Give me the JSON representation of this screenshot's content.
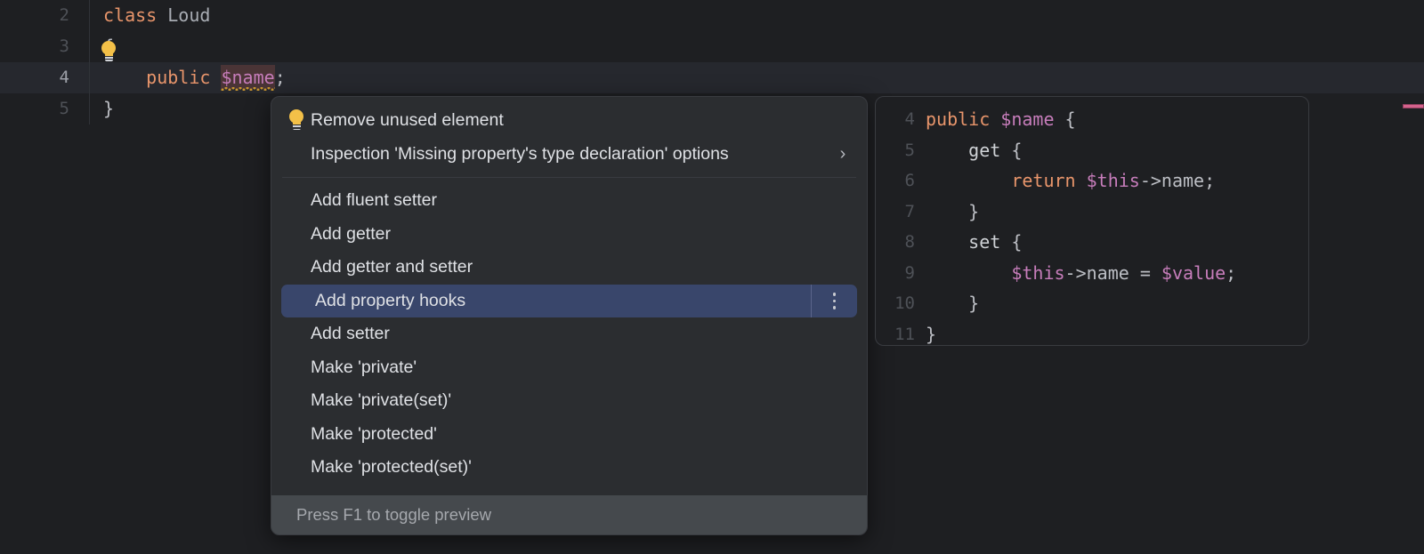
{
  "app": {
    "theme": "dark",
    "colors": {
      "editor_bg": "#1e1f22",
      "menu_bg": "#2b2d30",
      "selection": "#39466b",
      "footer_bg": "#45494d",
      "keyword": "#e8956b",
      "variable": "#c77dbb",
      "text": "#bcbec4",
      "error_marker": "#d4628c",
      "error_token_bg": "#4a3436",
      "squiggle": "#c8952f"
    }
  },
  "editor": {
    "name": "php-code-editor",
    "active_line": 4,
    "lines": [
      {
        "num": "2",
        "active": false,
        "tokens": [
          {
            "t": "class",
            "c": "kw"
          },
          {
            "t": " ",
            "c": "punc"
          },
          {
            "t": "Loud",
            "c": "cls"
          }
        ]
      },
      {
        "num": "3",
        "active": false,
        "tokens": [
          {
            "t": "{",
            "c": "punc"
          }
        ]
      },
      {
        "num": "4",
        "active": true,
        "tokens": [
          {
            "t": "    ",
            "c": "punc"
          },
          {
            "t": "public",
            "c": "kw"
          },
          {
            "t": " ",
            "c": "punc"
          },
          {
            "t": "$name",
            "c": "err"
          },
          {
            "t": ";",
            "c": "punc"
          }
        ]
      },
      {
        "num": "5",
        "active": false,
        "tokens": [
          {
            "t": "}",
            "c": "punc"
          }
        ]
      }
    ],
    "gutter_bulb_icon": "lightbulb-icon",
    "stripe_marker": {
      "name": "error-stripe-marker",
      "color": "#d4628c"
    }
  },
  "menu": {
    "name": "intention-actions-popup",
    "items": [
      {
        "label": "Remove unused element",
        "icon": "lightbulb-icon",
        "selected": false,
        "submenu": false,
        "more": false
      },
      {
        "label": "Inspection 'Missing property's type declaration' options",
        "icon": null,
        "selected": false,
        "submenu": true,
        "more": false
      },
      {
        "separator": true
      },
      {
        "label": "Add fluent setter",
        "icon": null,
        "selected": false,
        "submenu": false,
        "more": false
      },
      {
        "label": "Add getter",
        "icon": null,
        "selected": false,
        "submenu": false,
        "more": false
      },
      {
        "label": "Add getter and setter",
        "icon": null,
        "selected": false,
        "submenu": false,
        "more": false
      },
      {
        "label": "Add property hooks",
        "icon": null,
        "selected": true,
        "submenu": false,
        "more": true
      },
      {
        "label": "Add setter",
        "icon": null,
        "selected": false,
        "submenu": false,
        "more": false
      },
      {
        "label": "Make 'private'",
        "icon": null,
        "selected": false,
        "submenu": false,
        "more": false
      },
      {
        "label": "Make 'private(set)'",
        "icon": null,
        "selected": false,
        "submenu": false,
        "more": false
      },
      {
        "label": "Make 'protected'",
        "icon": null,
        "selected": false,
        "submenu": false,
        "more": false
      },
      {
        "label": "Make 'protected(set)'",
        "icon": null,
        "selected": false,
        "submenu": false,
        "more": false
      }
    ],
    "footer_hint": "Press F1 to toggle preview",
    "chevron_glyph": "›"
  },
  "preview": {
    "name": "intention-preview-panel",
    "lines": [
      {
        "num": "4",
        "tokens": [
          {
            "t": "public",
            "c": "kw"
          },
          {
            "t": " ",
            "c": "punc"
          },
          {
            "t": "$name",
            "c": "var"
          },
          {
            "t": " {",
            "c": "punc"
          }
        ]
      },
      {
        "num": "5",
        "tokens": [
          {
            "t": "    ",
            "c": "punc"
          },
          {
            "t": "get",
            "c": "txt"
          },
          {
            "t": " {",
            "c": "punc"
          }
        ]
      },
      {
        "num": "6",
        "tokens": [
          {
            "t": "        ",
            "c": "punc"
          },
          {
            "t": "return",
            "c": "kw"
          },
          {
            "t": " ",
            "c": "punc"
          },
          {
            "t": "$this",
            "c": "var"
          },
          {
            "t": "->name;",
            "c": "punc"
          }
        ]
      },
      {
        "num": "7",
        "tokens": [
          {
            "t": "    ",
            "c": "punc"
          },
          {
            "t": "}",
            "c": "punc"
          }
        ]
      },
      {
        "num": "8",
        "tokens": [
          {
            "t": "    ",
            "c": "punc"
          },
          {
            "t": "set",
            "c": "txt"
          },
          {
            "t": " {",
            "c": "punc"
          }
        ]
      },
      {
        "num": "9",
        "tokens": [
          {
            "t": "        ",
            "c": "punc"
          },
          {
            "t": "$this",
            "c": "var"
          },
          {
            "t": "->name = ",
            "c": "punc"
          },
          {
            "t": "$value",
            "c": "var"
          },
          {
            "t": ";",
            "c": "punc"
          }
        ]
      },
      {
        "num": "10",
        "tokens": [
          {
            "t": "    ",
            "c": "punc"
          },
          {
            "t": "}",
            "c": "punc"
          }
        ]
      },
      {
        "num": "11",
        "tokens": [
          {
            "t": "}",
            "c": "punc"
          }
        ]
      }
    ]
  }
}
